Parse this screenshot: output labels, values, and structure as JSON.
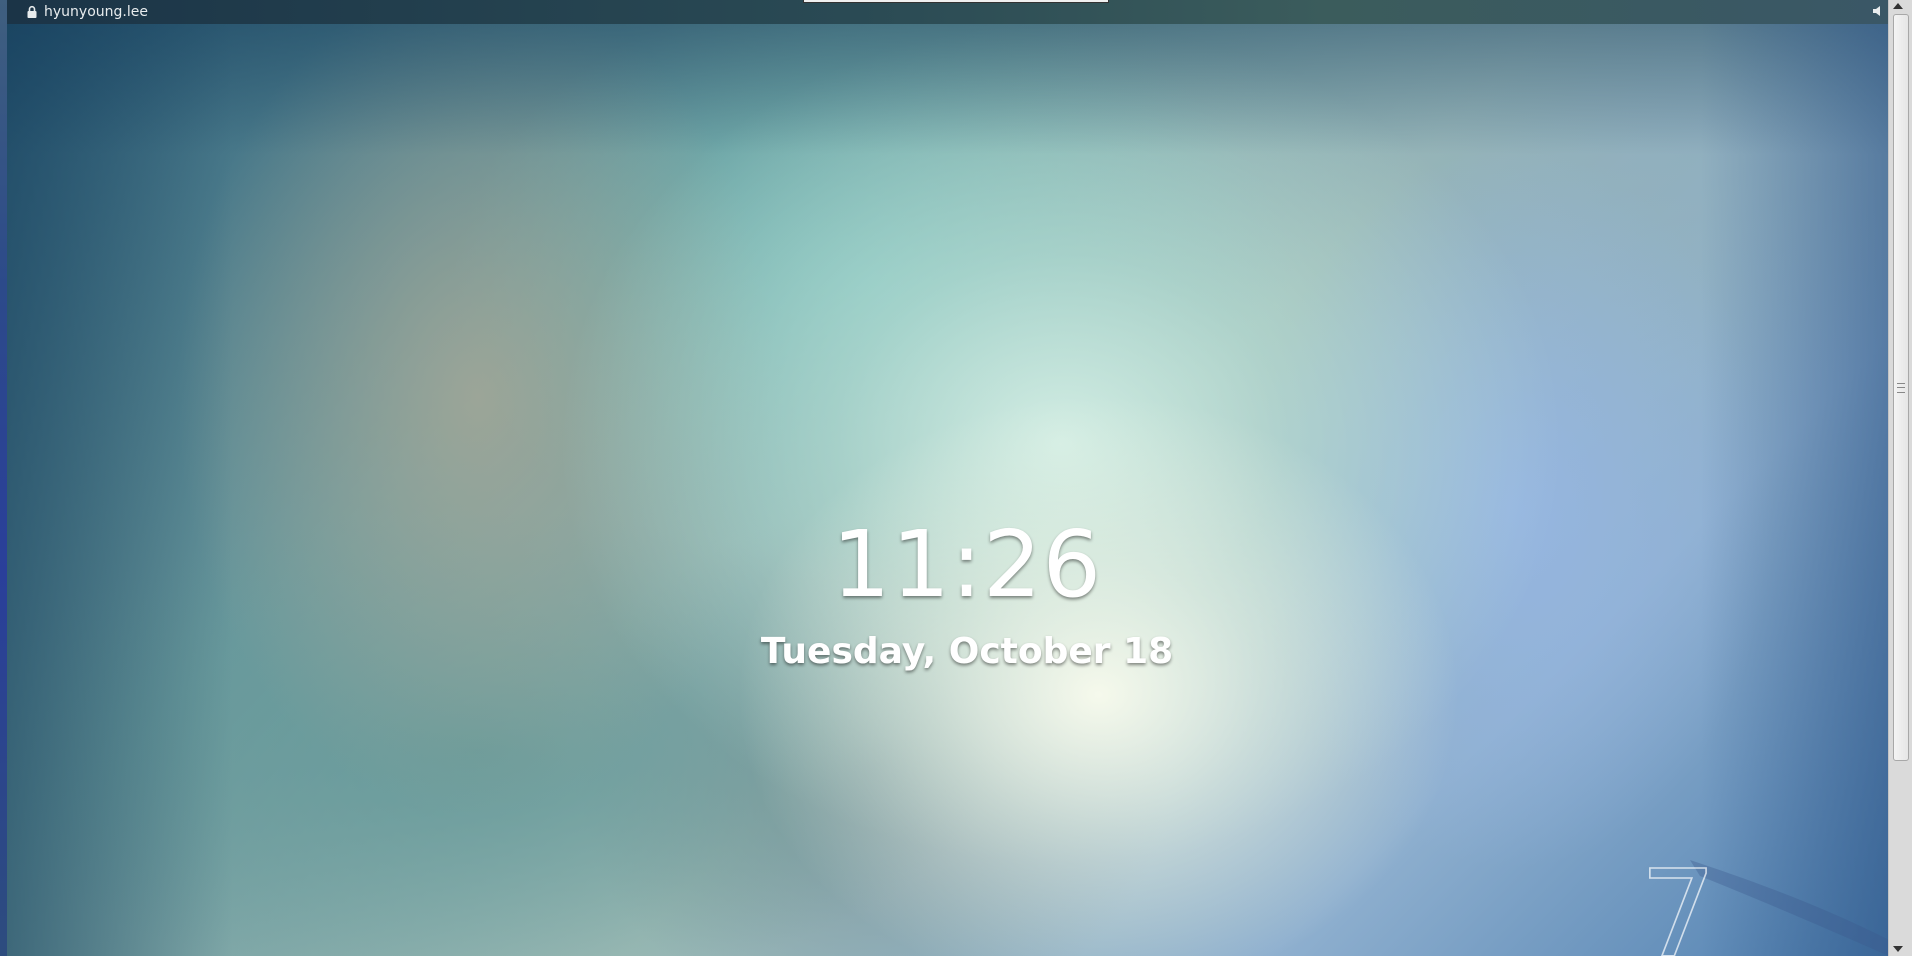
{
  "top_bar": {
    "username": "hyunyoung.lee",
    "lock_icon": "lock-icon",
    "volume_icon": "volume-icon"
  },
  "lock_screen": {
    "time": "11:26",
    "date": "Tuesday, October 18"
  },
  "wallpaper": {
    "watermark": "7"
  },
  "colors": {
    "clock_text": "#ffffff",
    "top_bar": "#1b3447",
    "scrollbar": "#dadada"
  }
}
